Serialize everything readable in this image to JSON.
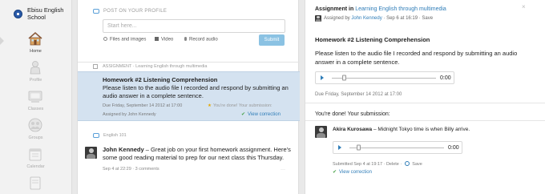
{
  "app": {
    "school_name": "Ebisu English School"
  },
  "sidebar": {
    "items": [
      {
        "label": "Home"
      },
      {
        "label": "Profile"
      },
      {
        "label": "Classes"
      },
      {
        "label": "Groups"
      },
      {
        "label": "Calendar"
      }
    ]
  },
  "composer": {
    "label": "POST ON YOUR PROFILE",
    "placeholder": "Start here...",
    "files_label": "Files and images",
    "video_label": "Video",
    "audio_label": "Record audio",
    "submit_label": "Submit"
  },
  "feed": {
    "assignment": {
      "header": "ASSIGNMENT · Learning English through multimedia",
      "title": "Homework #2 Listening Comprehension",
      "body": "Please listen to the audio file I recorded and respond by submitting an audio answer in a complete sentence.",
      "due": "Due Friday, September 14 2012 at 17:00",
      "done": "You're done! Your submission:",
      "assigned_by": "Assigned by John Kennedy",
      "view_correction": "View correction"
    },
    "post": {
      "group": "English 101",
      "author": "John Kennedy",
      "text": " – Great job on your first homework assignment. Here's some good reading material to prep for our next class this Thursday.",
      "meta": "Sep 4 at 22:29 · 3 comments"
    }
  },
  "detail": {
    "heading_prefix": "Assignment in ",
    "heading_class": "Learning English through multimedia",
    "assigned_prefix": "Assigned by ",
    "assigned_by": "John Kennedy",
    "assigned_suffix": " · Sep 6 at 16:19 · Save",
    "title": "Homework #2 Listening Comprehension",
    "body": "Please listen to the audio file I recorded and respond by submitting an audio answer in a complete sentence.",
    "player_time": "0:00",
    "due": "Due Friday, September 14 2012 at 17:00",
    "done": "You're done! Your submission:",
    "submission": {
      "author": "Akira Kurosawa",
      "text": " – Midnight Tokyo time is when Billy arrive.",
      "time": "0:00",
      "meta_prefix": "Submitted Sep 4 at 19:17 · Delete · ",
      "meta_suffix": " Save",
      "view_correction": "View correction"
    }
  },
  "colors": {
    "accent": "#2f7db8",
    "highlight": "#d4e2f0",
    "submit": "#8bc2e3"
  }
}
